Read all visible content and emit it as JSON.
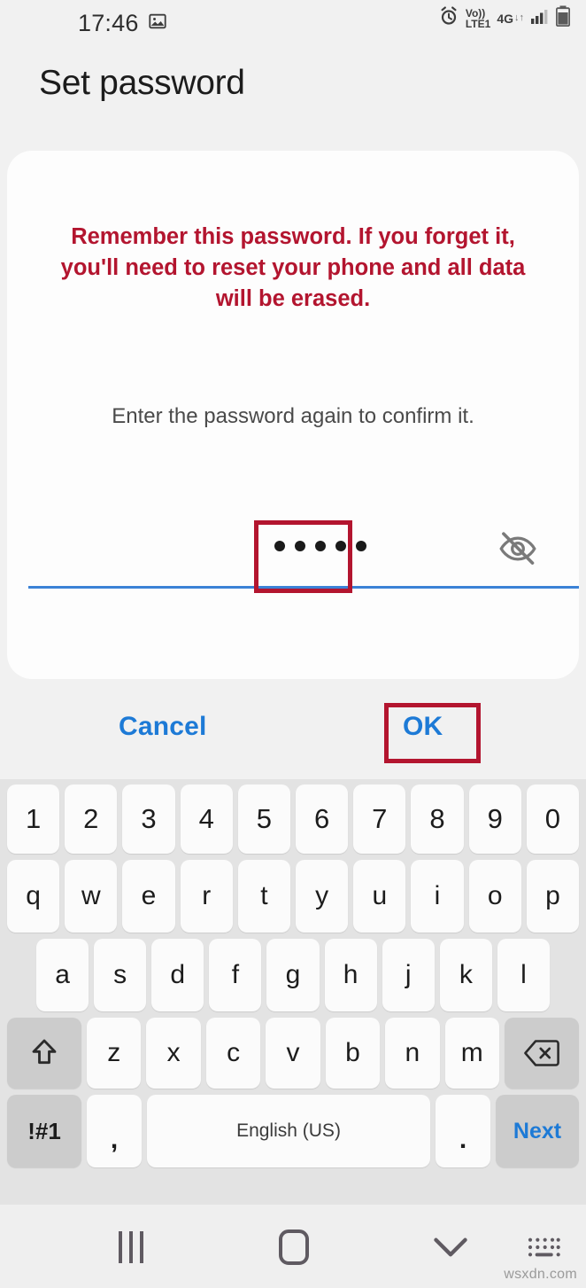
{
  "statusbar": {
    "time": "17:46",
    "image_icon": "image-icon",
    "alarm_icon": "alarm-clock-icon",
    "volte_line1": "Vo))",
    "volte_line2": "LTE1",
    "network_type": "4G",
    "data_arrows": "↓↑",
    "signal_icon": "signal-bars-icon",
    "battery_icon": "battery-icon"
  },
  "header": {
    "title": "Set password"
  },
  "dialog": {
    "warning": "Remember this password. If you forget it, you'll need to reset your phone and all data will be erased.",
    "instruction": "Enter the password again to confirm it.",
    "password_field": {
      "name": "password-input",
      "value": "•••••",
      "dot_count": 5,
      "masked": true,
      "toggle_icon": "eye-off-icon"
    },
    "buttons": {
      "cancel": "Cancel",
      "ok": "OK"
    }
  },
  "highlights": [
    {
      "name": "password-field-highlight",
      "color": "#b3152f"
    },
    {
      "name": "ok-button-highlight",
      "color": "#b3152f"
    }
  ],
  "keyboard": {
    "row_numbers": [
      "1",
      "2",
      "3",
      "4",
      "5",
      "6",
      "7",
      "8",
      "9",
      "0"
    ],
    "row_top": [
      "q",
      "w",
      "e",
      "r",
      "t",
      "y",
      "u",
      "i",
      "o",
      "p"
    ],
    "row_home": [
      "a",
      "s",
      "d",
      "f",
      "g",
      "h",
      "j",
      "k",
      "l"
    ],
    "row_bottom": [
      "z",
      "x",
      "c",
      "v",
      "b",
      "n",
      "m"
    ],
    "shift_icon": "shift-arrow-icon",
    "backspace_icon": "backspace-icon",
    "symbols_key": "!#1",
    "comma_key": ",",
    "space_key": "English (US)",
    "period_key": ".",
    "next_key": "Next"
  },
  "navbar": {
    "recents_icon": "recents-icon",
    "home_icon": "home-icon",
    "hide_keyboard_icon": "chevron-down-icon",
    "keyboard_switch_icon": "keyboard-switcher-icon"
  },
  "watermark": "wsxdn.com",
  "colors": {
    "accent_blue": "#1d7ad6",
    "warning_red": "#b3152f",
    "underline_blue": "#3b82d6",
    "background": "#f1f1f1",
    "card": "#fdfdfd",
    "keyboard_bg": "#e3e3e3"
  }
}
